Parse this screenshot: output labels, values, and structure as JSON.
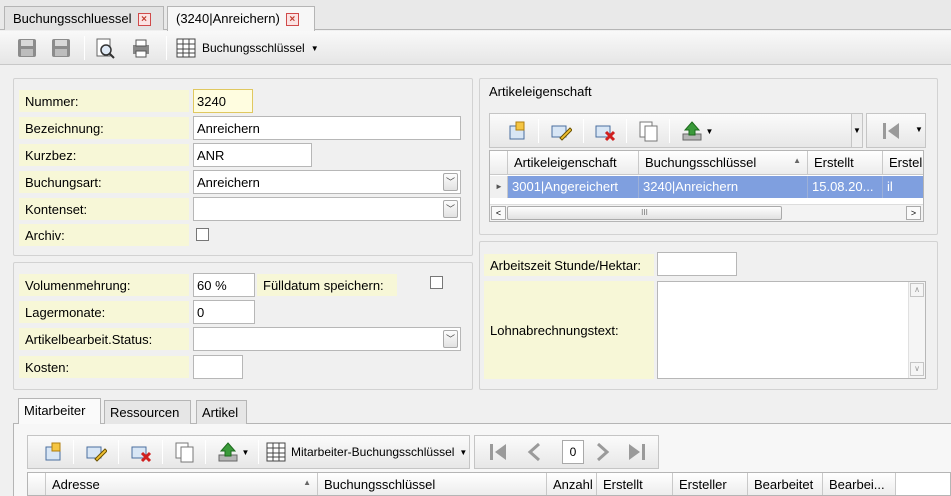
{
  "tabs": [
    {
      "label": "Buchungsschluessel"
    },
    {
      "label": "(3240|Anreichern)"
    }
  ],
  "toolbar": {
    "dropdown_label": "Buchungsschlüssel"
  },
  "form": {
    "nummer": {
      "label": "Nummer:",
      "value": "3240"
    },
    "bezeichnung": {
      "label": "Bezeichnung:",
      "value": "Anreichern"
    },
    "kurzbez": {
      "label": "Kurzbez:",
      "value": "ANR"
    },
    "buchungsart": {
      "label": "Buchungsart:",
      "value": "Anreichern"
    },
    "kontenset": {
      "label": "Kontenset:",
      "value": ""
    },
    "archiv": {
      "label": "Archiv:",
      "checked": false
    }
  },
  "form2": {
    "volumenmehrung": {
      "label": "Volumenmehrung:",
      "value": "60 %"
    },
    "fuelldatum": {
      "label": "Fülldatum speichern:",
      "checked": false
    },
    "lagermonate": {
      "label": "Lagermonate:",
      "value": "0"
    },
    "artikelstatus": {
      "label": "Artikelbearbeit.Status:",
      "value": ""
    },
    "kosten": {
      "label": "Kosten:",
      "value": ""
    }
  },
  "artikeleigenschaft": {
    "title": "Artikeleigenschaft",
    "columns": [
      "Artikeleigenschaft",
      "Buchungsschlüssel",
      "Erstellt",
      "Erstel"
    ],
    "rows": [
      [
        "3001|Angereichert",
        "3240|Anreichern",
        "15.08.20...",
        "il"
      ]
    ]
  },
  "arbeitszeit": {
    "label": "Arbeitszeit Stunde/Hektar:",
    "value": ""
  },
  "lohn": {
    "label": "Lohnabrechnungstext:",
    "value": ""
  },
  "bottom_tabs": [
    {
      "label": "Mitarbeiter"
    },
    {
      "label": "Ressourcen"
    },
    {
      "label": "Artikel"
    }
  ],
  "mitarbeiter": {
    "dropdown_label": "Mitarbeiter-Buchungsschlüssel",
    "page": "0",
    "columns": [
      "Adresse",
      "Buchungsschlüssel",
      "Anzahl",
      "Erstellt",
      "Ersteller",
      "Bearbeitet",
      "Bearbei..."
    ]
  },
  "colors": {
    "selection": "#7f9fdf",
    "label_bg": "#f7f7d7",
    "accent_green": "#3a9a3a"
  }
}
